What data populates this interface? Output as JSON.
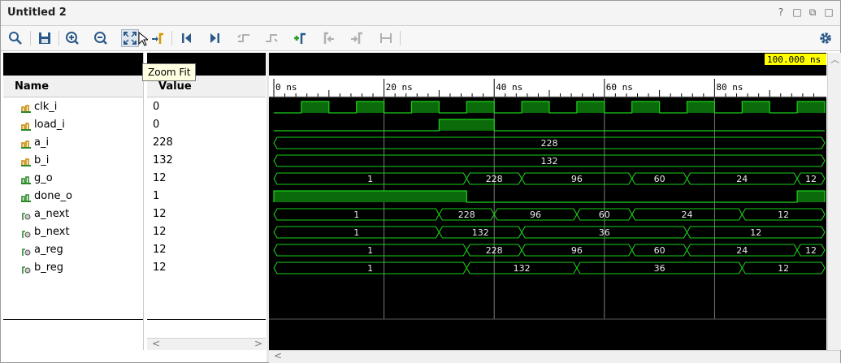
{
  "window": {
    "title": "Untitled 2",
    "controls": [
      "?",
      "□",
      "⧉",
      "□"
    ]
  },
  "tooltip": "Zoom Fit",
  "columns": {
    "name": "Name",
    "value": "Value"
  },
  "signals": [
    {
      "name": "clk_i",
      "value": "0",
      "kind": "input"
    },
    {
      "name": "load_i",
      "value": "0",
      "kind": "input"
    },
    {
      "name": "a_i",
      "value": "228",
      "kind": "input"
    },
    {
      "name": "b_i",
      "value": "132",
      "kind": "input"
    },
    {
      "name": "g_o",
      "value": "12",
      "kind": "output"
    },
    {
      "name": "done_o",
      "value": "1",
      "kind": "output"
    },
    {
      "name": "a_next",
      "value": "12",
      "kind": "internal"
    },
    {
      "name": "b_next",
      "value": "12",
      "kind": "internal"
    },
    {
      "name": "a_reg",
      "value": "12",
      "kind": "internal"
    },
    {
      "name": "b_reg",
      "value": "12",
      "kind": "internal"
    }
  ],
  "timeline": {
    "cursor_label": "100.000 ns",
    "ticks": [
      "0 ns",
      "20 ns",
      "40 ns",
      "60 ns",
      "80 ns"
    ],
    "tick_values_ns": [
      0,
      20,
      40,
      60,
      80
    ],
    "range_ns": [
      0,
      100
    ]
  },
  "waves": {
    "clk_i": {
      "type": "clock",
      "period_ns": 10,
      "high_from_ns": 5
    },
    "load_i": {
      "type": "bit",
      "high": [
        [
          30,
          40
        ]
      ]
    },
    "a_i": {
      "type": "bus",
      "segments": [
        {
          "from": 0,
          "to": 100,
          "label": "228"
        }
      ]
    },
    "b_i": {
      "type": "bus",
      "segments": [
        {
          "from": 0,
          "to": 100,
          "label": "132"
        }
      ]
    },
    "g_o": {
      "type": "bus",
      "segments": [
        {
          "from": 0,
          "to": 35,
          "label": "1"
        },
        {
          "from": 35,
          "to": 45,
          "label": "228"
        },
        {
          "from": 45,
          "to": 65,
          "label": "96"
        },
        {
          "from": 65,
          "to": 75,
          "label": "60"
        },
        {
          "from": 75,
          "to": 95,
          "label": "24"
        },
        {
          "from": 95,
          "to": 100,
          "label": "12"
        }
      ]
    },
    "done_o": {
      "type": "bit",
      "high": [
        [
          0,
          35
        ],
        [
          95,
          100
        ]
      ]
    },
    "a_next": {
      "type": "bus",
      "segments": [
        {
          "from": 0,
          "to": 30,
          "label": "1"
        },
        {
          "from": 30,
          "to": 40,
          "label": "228"
        },
        {
          "from": 40,
          "to": 55,
          "label": "96"
        },
        {
          "from": 55,
          "to": 65,
          "label": "60"
        },
        {
          "from": 65,
          "to": 85,
          "label": "24"
        },
        {
          "from": 85,
          "to": 100,
          "label": "12"
        }
      ]
    },
    "b_next": {
      "type": "bus",
      "segments": [
        {
          "from": 0,
          "to": 30,
          "label": "1"
        },
        {
          "from": 30,
          "to": 45,
          "label": "132"
        },
        {
          "from": 45,
          "to": 75,
          "label": "36"
        },
        {
          "from": 75,
          "to": 100,
          "label": "12"
        }
      ]
    },
    "a_reg": {
      "type": "bus",
      "segments": [
        {
          "from": 0,
          "to": 35,
          "label": "1"
        },
        {
          "from": 35,
          "to": 45,
          "label": "228"
        },
        {
          "from": 45,
          "to": 65,
          "label": "96"
        },
        {
          "from": 65,
          "to": 75,
          "label": "60"
        },
        {
          "from": 75,
          "to": 95,
          "label": "24"
        },
        {
          "from": 95,
          "to": 100,
          "label": "12"
        }
      ]
    },
    "b_reg": {
      "type": "bus",
      "segments": [
        {
          "from": 0,
          "to": 35,
          "label": "1"
        },
        {
          "from": 35,
          "to": 55,
          "label": "132"
        },
        {
          "from": 55,
          "to": 85,
          "label": "36"
        },
        {
          "from": 85,
          "to": 100,
          "label": "12"
        }
      ]
    }
  },
  "colors": {
    "wave": "#19d119",
    "wave_fill": "#0b6b0b",
    "background": "#000000",
    "cursor_label_bg": "#ffff00",
    "gridline": "#7a7a7a"
  },
  "toolbar": [
    "search-icon",
    "save-icon",
    "zoom-in-icon",
    "zoom-out-icon",
    "zoom-fit-icon",
    "go-to-cursor-icon",
    "go-to-start-icon",
    "go-to-end-icon",
    "previous-transition-icon",
    "next-transition-icon",
    "add-marker-icon",
    "previous-marker-icon",
    "next-marker-icon",
    "swap-cursors-icon",
    "settings-gear-icon"
  ]
}
